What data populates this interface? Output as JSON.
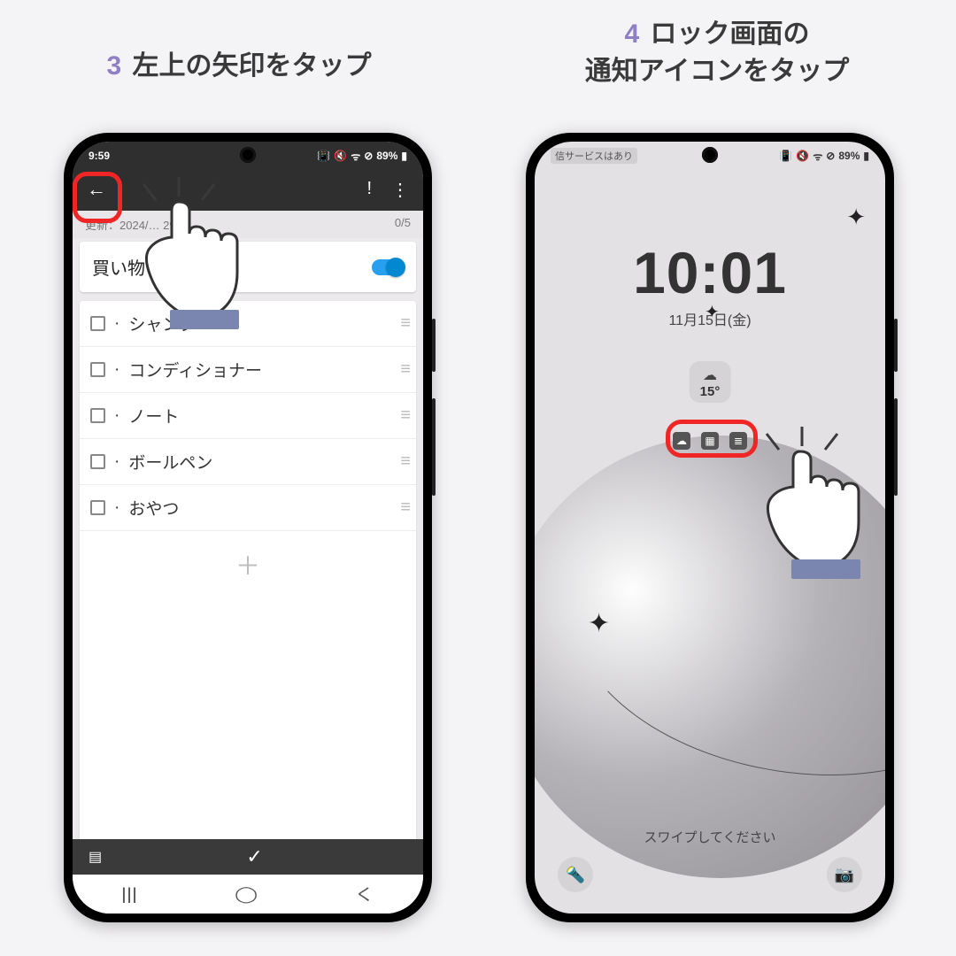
{
  "steps": {
    "left": {
      "num": "3",
      "text": "左上の矢印をタップ"
    },
    "right": {
      "num": "4",
      "text": "ロック画面の\n通知アイコンをタップ"
    }
  },
  "status": {
    "left_time": "9:59",
    "battery": "89%",
    "carrier": "信サービスはあり"
  },
  "app": {
    "update_label": "更新：2024/…      29",
    "counter": "0/5",
    "list_title": "買い物",
    "items": [
      "シャンプー",
      "コンディショナー",
      "ノート",
      "ボールペン",
      "おやつ"
    ],
    "add": "＋"
  },
  "lock": {
    "time": "10:01",
    "date": "11月15日(金)",
    "weather_temp": "15°",
    "swipe": "スワイプしてください"
  },
  "nav": {
    "recent": "|||",
    "home": "◯",
    "back": "く"
  }
}
